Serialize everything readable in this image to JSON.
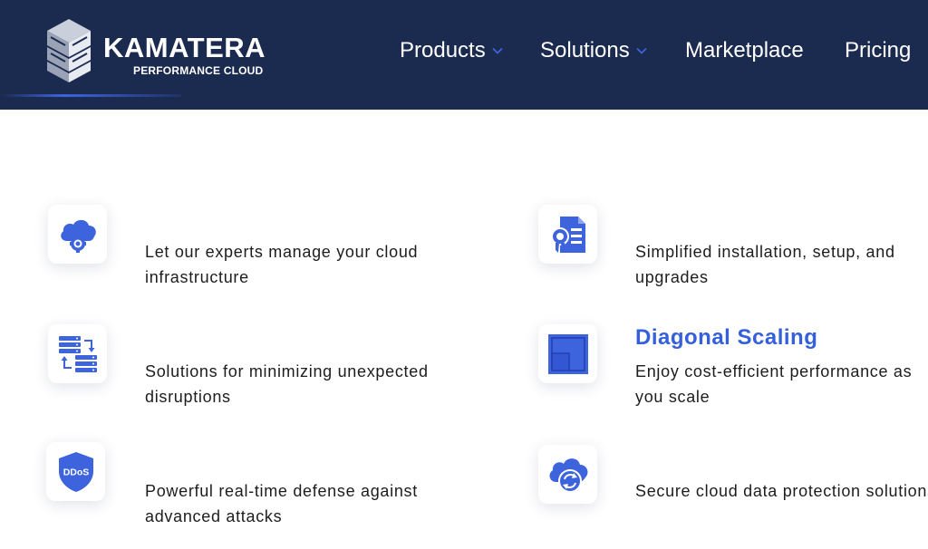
{
  "brand": {
    "name": "KAMATERA",
    "tagline": "PERFORMANCE CLOUD"
  },
  "nav": {
    "items": [
      {
        "label": "Products",
        "has_dropdown": true
      },
      {
        "label": "Solutions",
        "has_dropdown": true
      },
      {
        "label": "Marketplace",
        "has_dropdown": false
      },
      {
        "label": "Pricing",
        "has_dropdown": false
      }
    ]
  },
  "colors": {
    "header_bg": "#1b2a4f",
    "accent": "#3d63dd",
    "title_accent": "#3560dc"
  },
  "features": [
    {
      "icon": "cloud-gear-icon",
      "title": "",
      "text": "Let our experts manage your cloud infrastructure"
    },
    {
      "icon": "certificate-document-icon",
      "title": "",
      "text": "Simplified installation, setup, and upgrades"
    },
    {
      "icon": "server-migration-icon",
      "title": "",
      "text": "Solutions for minimizing unexpected disruptions"
    },
    {
      "icon": "diagonal-scaling-icon",
      "title": "Diagonal Scaling",
      "text": "Enjoy cost-efficient performance as you scale"
    },
    {
      "icon": "ddos-shield-icon",
      "title": "",
      "text": "Powerful real-time defense against advanced attacks",
      "icon_text": "DDoS"
    },
    {
      "icon": "cloud-sync-icon",
      "title": "",
      "text": "Secure cloud data protection solutions"
    }
  ]
}
